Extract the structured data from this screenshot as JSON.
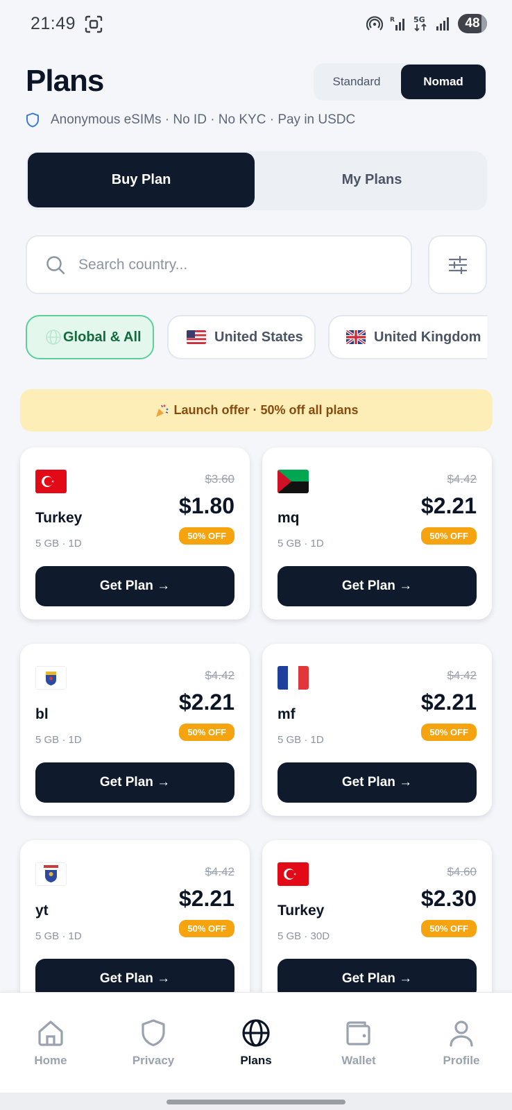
{
  "status_bar": {
    "time": "21:49",
    "battery": "48"
  },
  "header": {
    "title": "Plans",
    "mode_options": [
      "Standard",
      "Nomad"
    ],
    "selected_mode": "Nomad",
    "subtitle": "Anonymous eSIMs · No ID · No KYC · Pay in USDC"
  },
  "tabs": {
    "buy_label": "Buy Plan",
    "my_label": "My Plans",
    "active": "Buy Plan"
  },
  "search": {
    "placeholder": "Search country...",
    "value": ""
  },
  "chips": [
    {
      "label": "Global & All",
      "icon": "globe-icon",
      "selected": true
    },
    {
      "label": "United States",
      "icon": "us-flag",
      "selected": false
    },
    {
      "label": "United Kingdom",
      "icon": "uk-flag",
      "selected": false
    }
  ],
  "offer_banner": {
    "icon": "party-popper",
    "text": "Launch offer · 50% off all plans"
  },
  "plans": [
    {
      "name": "Turkey",
      "meta": "5 GB · 1D",
      "old_price": "$3.60",
      "price": "$1.80",
      "badge": "50% OFF",
      "button": "Get Plan →",
      "flag": "tr"
    },
    {
      "name": "mq",
      "meta": "5 GB · 1D",
      "old_price": "$4.42",
      "price": "$2.21",
      "badge": "50% OFF",
      "button": "Get Plan →",
      "flag": "mq"
    },
    {
      "name": "bl",
      "meta": "5 GB · 1D",
      "old_price": "$4.42",
      "price": "$2.21",
      "badge": "50% OFF",
      "button": "Get Plan →",
      "flag": "bl"
    },
    {
      "name": "mf",
      "meta": "5 GB · 1D",
      "old_price": "$4.42",
      "price": "$2.21",
      "badge": "50% OFF",
      "button": "Get Plan →",
      "flag": "fr"
    },
    {
      "name": "yt",
      "meta": "5 GB · 1D",
      "old_price": "$4.42",
      "price": "$2.21",
      "badge": "50% OFF",
      "button": "Get Plan →",
      "flag": "yt"
    },
    {
      "name": "Turkey",
      "meta": "5 GB · 30D",
      "old_price": "$4.60",
      "price": "$2.30",
      "badge": "50% OFF",
      "button": "Get Plan →",
      "flag": "tr"
    }
  ],
  "bottom_nav": [
    {
      "label": "Home",
      "icon": "home-icon",
      "active": false
    },
    {
      "label": "Privacy",
      "icon": "shield-icon",
      "active": false
    },
    {
      "label": "Plans",
      "icon": "globe-icon",
      "active": true
    },
    {
      "label": "Wallet",
      "icon": "wallet-icon",
      "active": false
    },
    {
      "label": "Profile",
      "icon": "user-icon",
      "active": false
    }
  ],
  "colors": {
    "primary": "#0f1b2d",
    "background": "#f4f6fa",
    "accent_green": "#5ccf97",
    "badge_orange": "#f5a30f",
    "banner_bg": "#fdeeb8"
  }
}
